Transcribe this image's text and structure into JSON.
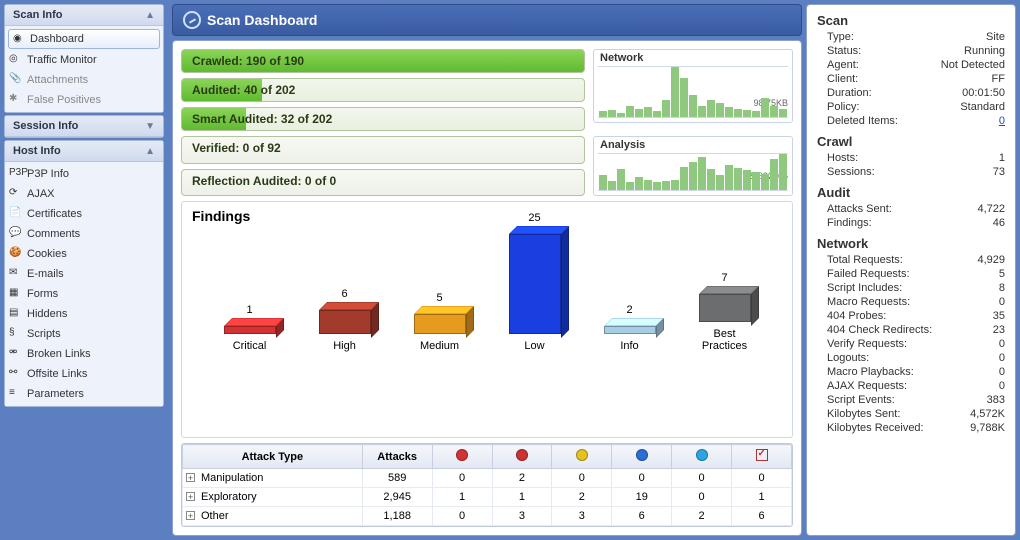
{
  "sidebar": {
    "scan_info": {
      "title": "Scan Info",
      "items": [
        {
          "icon": "dashboard",
          "label": "Dashboard",
          "selected": true
        },
        {
          "icon": "monitor",
          "label": "Traffic Monitor"
        },
        {
          "icon": "attach",
          "label": "Attachments",
          "dim": true
        },
        {
          "icon": "fp",
          "label": "False Positives",
          "dim": true
        }
      ]
    },
    "session_info": {
      "title": "Session Info"
    },
    "host_info": {
      "title": "Host Info",
      "items": [
        {
          "icon": "p3p",
          "label": "P3P Info"
        },
        {
          "icon": "ajax",
          "label": "AJAX"
        },
        {
          "icon": "cert",
          "label": "Certificates"
        },
        {
          "icon": "comment",
          "label": "Comments"
        },
        {
          "icon": "cookie",
          "label": "Cookies"
        },
        {
          "icon": "email",
          "label": "E-mails"
        },
        {
          "icon": "form",
          "label": "Forms"
        },
        {
          "icon": "hidden",
          "label": "Hiddens"
        },
        {
          "icon": "script",
          "label": "Scripts"
        },
        {
          "icon": "broken",
          "label": "Broken Links"
        },
        {
          "icon": "offsite",
          "label": "Offsite Links"
        },
        {
          "icon": "param",
          "label": "Parameters"
        }
      ]
    }
  },
  "title": "Scan Dashboard",
  "progress": [
    {
      "label": "Crawled: 190 of 190",
      "pct": 100
    },
    {
      "label": "Audited: 40 of 202",
      "pct": 20
    },
    {
      "label": "Smart Audited: 32 of 202",
      "pct": 16
    },
    {
      "label": "Verified: 0 of 92",
      "pct": 0
    },
    {
      "label": "Reflection Audited: 0 of 0",
      "pct": 0
    }
  ],
  "mini": {
    "network": {
      "title": "Network",
      "value": "98.75KB",
      "bars": [
        10,
        12,
        8,
        20,
        15,
        18,
        10,
        30,
        90,
        70,
        40,
        20,
        30,
        25,
        18,
        14,
        12,
        10,
        35,
        20,
        15
      ]
    },
    "analysis": {
      "title": "Analysis",
      "value": "20692766",
      "bars": [
        30,
        18,
        40,
        15,
        25,
        20,
        15,
        18,
        20,
        45,
        55,
        65,
        40,
        30,
        48,
        42,
        38,
        35,
        32,
        60,
        70
      ]
    }
  },
  "chart_data": {
    "type": "bar",
    "title": "Findings",
    "categories": [
      "Critical",
      "High",
      "Medium",
      "Low",
      "Info",
      "Best Practices"
    ],
    "values": [
      1,
      6,
      5,
      25,
      2,
      7
    ],
    "colors": [
      "#d53333",
      "#a33b2c",
      "#e69a1e",
      "#1a3fe0",
      "#a5cde6",
      "#6b6d6f"
    ],
    "ylim": [
      0,
      25
    ]
  },
  "attack_table": {
    "headers": [
      "Attack Type",
      "Attacks",
      "critical",
      "high",
      "medium",
      "low",
      "info",
      "check"
    ],
    "header_colors": [
      "",
      "",
      "#d53333",
      "#cc3333",
      "#e6c21e",
      "#2a6fd6",
      "#2aa6e6",
      ""
    ],
    "rows": [
      {
        "name": "Manipulation",
        "attacks": "589",
        "counts": [
          "0",
          "2",
          "0",
          "0",
          "0",
          "0"
        ]
      },
      {
        "name": "Exploratory",
        "attacks": "2,945",
        "counts": [
          "1",
          "1",
          "2",
          "19",
          "0",
          "1"
        ]
      },
      {
        "name": "Other",
        "attacks": "1,188",
        "counts": [
          "0",
          "3",
          "3",
          "6",
          "2",
          "6"
        ]
      }
    ]
  },
  "stats": {
    "groups": [
      {
        "title": "Scan",
        "rows": [
          {
            "k": "Type:",
            "v": "Site"
          },
          {
            "k": "Status:",
            "v": "Running"
          },
          {
            "k": "Agent:",
            "v": "Not Detected"
          },
          {
            "k": "Client:",
            "v": "FF"
          },
          {
            "k": "Duration:",
            "v": "00:01:50"
          },
          {
            "k": "Policy:",
            "v": "Standard"
          },
          {
            "k": "Deleted Items:",
            "v": "0",
            "link": true
          }
        ]
      },
      {
        "title": "Crawl",
        "rows": [
          {
            "k": "Hosts:",
            "v": "1"
          },
          {
            "k": "Sessions:",
            "v": "73"
          }
        ]
      },
      {
        "title": "Audit",
        "rows": [
          {
            "k": "Attacks Sent:",
            "v": "4,722"
          },
          {
            "k": "Findings:",
            "v": "46"
          }
        ]
      },
      {
        "title": "Network",
        "rows": [
          {
            "k": "Total Requests:",
            "v": "4,929"
          },
          {
            "k": "Failed Requests:",
            "v": "5"
          },
          {
            "k": "Script Includes:",
            "v": "8"
          },
          {
            "k": "Macro Requests:",
            "v": "0"
          },
          {
            "k": "404 Probes:",
            "v": "35"
          },
          {
            "k": "404 Check Redirects:",
            "v": "23"
          },
          {
            "k": "Verify Requests:",
            "v": "0"
          },
          {
            "k": "Logouts:",
            "v": "0"
          },
          {
            "k": "Macro Playbacks:",
            "v": "0"
          },
          {
            "k": "AJAX Requests:",
            "v": "0"
          },
          {
            "k": "Script Events:",
            "v": "383"
          },
          {
            "k": "Kilobytes Sent:",
            "v": "4,572K"
          },
          {
            "k": "Kilobytes Received:",
            "v": "9,788K"
          }
        ]
      }
    ]
  }
}
